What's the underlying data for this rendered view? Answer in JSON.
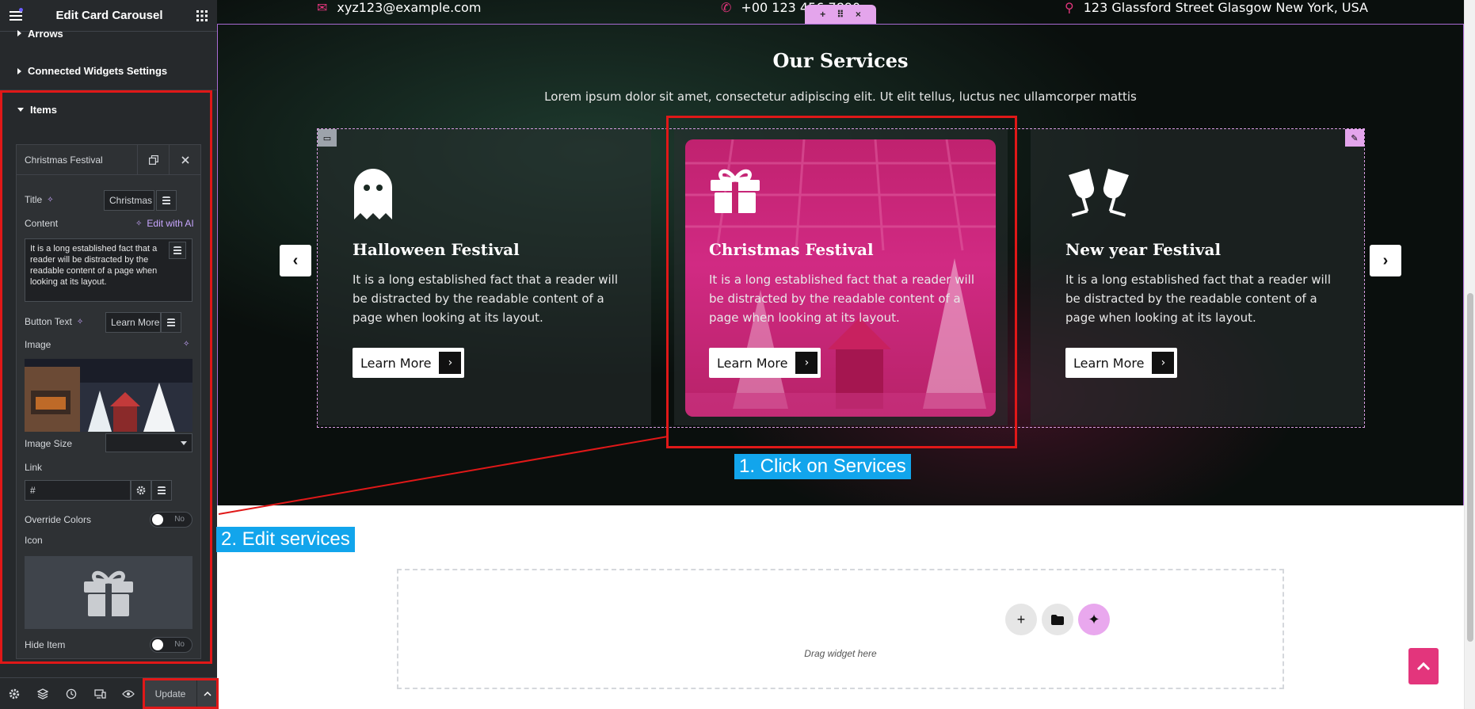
{
  "editor": {
    "title": "Edit Card Carousel",
    "sections": {
      "arrows": "Arrows",
      "connected": "Connected Widgets Settings",
      "items": "Items"
    },
    "item": {
      "header_label": "Christmas Festival",
      "title_label": "Title",
      "title_value": "Christmas Festival",
      "content_label": "Content",
      "edit_ai_label": "Edit with AI",
      "content_value": "It is a long established fact that a reader will be distracted by the readable content of a page when looking at its layout.",
      "button_text_label": "Button Text",
      "button_text_value": "Learn More",
      "image_label": "Image",
      "image_size_label": "Image Size",
      "image_size_value": "",
      "link_label": "Link",
      "link_value": "#",
      "override_colors_label": "Override Colors",
      "override_colors_state": "No",
      "icon_label": "Icon",
      "icon_name": "gift-icon",
      "hide_item_label": "Hide Item",
      "hide_item_state": "No"
    },
    "footer": {
      "update_label": "Update"
    }
  },
  "preview": {
    "contacts": {
      "email": "xyz123@example.com",
      "phone": "+00 123 456 7890",
      "address": "123 Glassford Street Glasgow New York, USA"
    },
    "services": {
      "title": "Our Services",
      "subtitle": "Lorem ipsum dolor sit amet, consectetur adipiscing elit. Ut elit tellus, luctus nec ullamcorper mattis"
    },
    "cards": [
      {
        "title": "Halloween Festival",
        "text": "It is a long established fact that a reader will be distracted by the readable content of a page when looking at its layout.",
        "button": "Learn More",
        "icon": "ghost-icon"
      },
      {
        "title": "Christmas Festival",
        "text": "It is a long established fact that a reader will be distracted by the readable content of a page when looking at its layout.",
        "button": "Learn More",
        "icon": "gift-icon"
      },
      {
        "title": "New year Festival",
        "text": "It is a long established fact that a reader will be distracted by the readable content of a page when looking at its layout.",
        "button": "Learn More",
        "icon": "glasses-cheers-icon"
      }
    ],
    "dropzone_text": "Drag widget here"
  },
  "annotations": {
    "step1": "1. Click on Services",
    "step2": "2. Edit services"
  },
  "colors": {
    "accent_pink": "#e3357c",
    "editor_bg": "#26292c",
    "annotation_blue": "#12a5ec",
    "annotation_red": "#e01818"
  }
}
